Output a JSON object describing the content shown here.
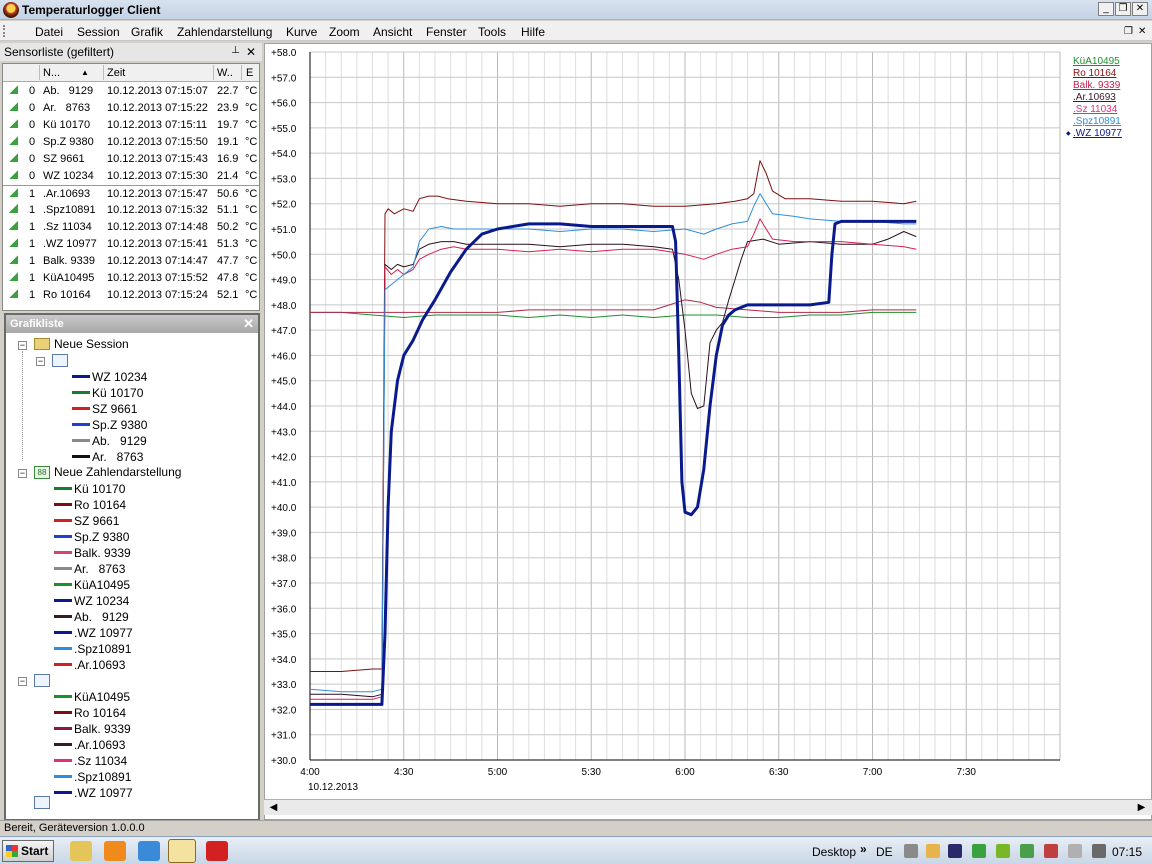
{
  "window": {
    "title": "Temperaturlogger Client",
    "min": "_",
    "max": "❐",
    "close": "✕"
  },
  "menu": [
    "Datei",
    "Session",
    "Grafik",
    "Zahlendarstellung",
    "Kurve",
    "Zoom",
    "Ansicht",
    "Fenster",
    "Tools",
    "Hilfe"
  ],
  "mdi": {
    "restore": "❐",
    "close": "✕"
  },
  "sensor_panel": {
    "title": "Sensorliste (gefiltert)",
    "pin": "⊥",
    "close": "✕",
    "columns": [
      "N...",
      "Zeit",
      "W..",
      "E"
    ],
    "rows": [
      [
        "0",
        "Ab.   9129",
        "10.12.2013 07:15:07",
        "22.7",
        "°C"
      ],
      [
        "0",
        "Ar.   8763",
        "10.12.2013 07:15:22",
        "23.9",
        "°C"
      ],
      [
        "0",
        "Kü 10170",
        "10.12.2013 07:15:11",
        "19.7",
        "°C"
      ],
      [
        "0",
        "Sp.Z 9380",
        "10.12.2013 07:15:50",
        "19.1",
        "°C"
      ],
      [
        "0",
        "SZ 9661",
        "10.12.2013 07:15:43",
        "16.9",
        "°C"
      ],
      [
        "0",
        "WZ 10234",
        "10.12.2013 07:15:30",
        "21.4",
        "°C"
      ],
      [
        "1",
        ".Ar.10693",
        "10.12.2013 07:15:47",
        "50.6",
        "°C"
      ],
      [
        "1",
        ".Spz10891",
        "10.12.2013 07:15:32",
        "51.1",
        "°C"
      ],
      [
        "1",
        ".Sz 11034",
        "10.12.2013 07:14:48",
        "50.2",
        "°C"
      ],
      [
        "1",
        ".WZ 10977",
        "10.12.2013 07:15:41",
        "51.3",
        "°C"
      ],
      [
        "1",
        "Balk. 9339",
        "10.12.2013 07:14:47",
        "47.7",
        "°C"
      ],
      [
        "1",
        "KüA10495",
        "10.12.2013 07:15:52",
        "47.8",
        "°C"
      ],
      [
        "1",
        "Ro 10164",
        "10.12.2013 07:15:24",
        "52.1",
        "°C"
      ]
    ]
  },
  "graf_panel": {
    "title": "Grafikliste",
    "close": "✕",
    "session": "Neue Session",
    "session_items": [
      {
        "name": "WZ 10234",
        "color": "#0a1a8c"
      },
      {
        "name": "Kü 10170",
        "color": "#1f7a2e"
      },
      {
        "name": "SZ 9661",
        "color": "#d42020"
      },
      {
        "name": "Sp.Z 9380",
        "color": "#1f3fd0"
      },
      {
        "name": "Ab.   9129",
        "color": "#8a8a8a"
      },
      {
        "name": "Ar.   8763",
        "color": "#111111"
      }
    ],
    "zahlen": "Neue Zahlendarstellung",
    "zahlen_items": [
      {
        "name": "Kü 10170",
        "color": "#1f7a2e"
      },
      {
        "name": "Ro 10164",
        "color": "#7a1010"
      },
      {
        "name": "SZ 9661",
        "color": "#d42020"
      },
      {
        "name": "Sp.Z 9380",
        "color": "#1f3fd0"
      },
      {
        "name": "Balk. 9339",
        "color": "#d6436b"
      },
      {
        "name": "Ar.   8763",
        "color": "#8a8a8a"
      },
      {
        "name": "KüA10495",
        "color": "#1f8f2e"
      },
      {
        "name": "WZ 10234",
        "color": "#0a1a8c"
      },
      {
        "name": "Ab.   9129",
        "color": "#3a1a1a"
      },
      {
        "name": ".WZ 10977",
        "color": "#0a1a8c"
      },
      {
        "name": ".Spz10891",
        "color": "#2f8fd8"
      },
      {
        "name": ".Ar.10693",
        "color": "#d42020"
      }
    ],
    "chart2_items": [
      {
        "name": "KüA10495",
        "color": "#1f8f2e"
      },
      {
        "name": "Ro 10164",
        "color": "#7a1010"
      },
      {
        "name": "Balk. 9339",
        "color": "#8a1a3a"
      },
      {
        "name": ".Ar.10693",
        "color": "#3a1a2a"
      },
      {
        "name": ".Sz 11034",
        "color": "#e0307a"
      },
      {
        "name": ".Spz10891",
        "color": "#2f8fd8"
      },
      {
        "name": ".WZ 10977",
        "color": "#0a1a8c"
      }
    ]
  },
  "status": "Bereit, Geräteversion 1.0.0.0",
  "legend": [
    {
      "name": "KüA10495",
      "color": "#1f8f2e"
    },
    {
      "name": "Ro 10164",
      "color": "#8a1010"
    },
    {
      "name": "Balk. 9339",
      "color": "#c0204a"
    },
    {
      "name": ".Ar.10693",
      "color": "#3a1a2a"
    },
    {
      "name": ".Sz 11034",
      "color": "#e0307a"
    },
    {
      "name": ".Spz10891",
      "color": "#2f8fd8"
    },
    {
      "name": ".WZ 10977",
      "color": "#0a1a8c"
    }
  ],
  "chart_data": {
    "type": "line",
    "xlabel": "",
    "ylabel": "",
    "date_label": "10.12.2013",
    "x_ticks": [
      "4:00",
      "4:30",
      "5:00",
      "5:30",
      "6:00",
      "6:30",
      "7:00",
      "7:30"
    ],
    "y_ticks": [
      "+30.0",
      "+31.0",
      "+32.0",
      "+33.0",
      "+34.0",
      "+35.0",
      "+36.0",
      "+37.0",
      "+38.0",
      "+39.0",
      "+40.0",
      "+41.0",
      "+42.0",
      "+43.0",
      "+44.0",
      "+45.0",
      "+46.0",
      "+47.0",
      "+48.0",
      "+49.0",
      "+50.0",
      "+51.0",
      "+52.0",
      "+53.0",
      "+54.0",
      "+55.0",
      "+56.0",
      "+57.0",
      "+58.0"
    ],
    "ylim": [
      30,
      58
    ],
    "grid": true,
    "legend_position": "top-right",
    "series": [
      {
        "name": "KüA10495",
        "color": "#1f8f2e",
        "width": 1,
        "points": [
          [
            0,
            47.7
          ],
          [
            10,
            47.7
          ],
          [
            20,
            47.6
          ],
          [
            30,
            47.5
          ],
          [
            40,
            47.6
          ],
          [
            50,
            47.6
          ],
          [
            60,
            47.6
          ],
          [
            70,
            47.5
          ],
          [
            80,
            47.6
          ],
          [
            90,
            47.5
          ],
          [
            100,
            47.6
          ],
          [
            110,
            47.5
          ],
          [
            120,
            47.6
          ],
          [
            130,
            47.6
          ],
          [
            140,
            47.5
          ],
          [
            150,
            47.5
          ],
          [
            160,
            47.6
          ],
          [
            170,
            47.6
          ],
          [
            180,
            47.7
          ],
          [
            190,
            47.7
          ],
          [
            194,
            47.7
          ]
        ]
      },
      {
        "name": "Ro 10164",
        "color": "#7a1010",
        "width": 1,
        "points": [
          [
            0,
            33.5
          ],
          [
            10,
            33.5
          ],
          [
            20,
            33.6
          ],
          [
            23,
            33.6
          ],
          [
            24,
            51.6
          ],
          [
            25,
            51.8
          ],
          [
            27,
            51.6
          ],
          [
            30,
            51.8
          ],
          [
            33,
            51.7
          ],
          [
            35,
            52.2
          ],
          [
            38,
            52.3
          ],
          [
            41,
            52.3
          ],
          [
            44,
            52.2
          ],
          [
            50,
            52.1
          ],
          [
            60,
            52.0
          ],
          [
            70,
            52.0
          ],
          [
            80,
            51.9
          ],
          [
            90,
            52.0
          ],
          [
            100,
            52.0
          ],
          [
            110,
            51.9
          ],
          [
            120,
            51.9
          ],
          [
            130,
            52.0
          ],
          [
            136,
            52.1
          ],
          [
            140,
            52.2
          ],
          [
            142,
            52.4
          ],
          [
            144,
            53.7
          ],
          [
            146,
            53.2
          ],
          [
            148,
            52.5
          ],
          [
            152,
            52.2
          ],
          [
            160,
            52.2
          ],
          [
            170,
            52.1
          ],
          [
            180,
            52.1
          ],
          [
            190,
            52.0
          ],
          [
            194,
            52.1
          ]
        ]
      },
      {
        "name": "Balk. 9339",
        "color": "#b0284a",
        "width": 1,
        "points": [
          [
            0,
            47.7
          ],
          [
            10,
            47.7
          ],
          [
            20,
            47.7
          ],
          [
            30,
            47.7
          ],
          [
            40,
            47.7
          ],
          [
            50,
            47.7
          ],
          [
            60,
            47.7
          ],
          [
            70,
            47.8
          ],
          [
            80,
            47.8
          ],
          [
            90,
            47.8
          ],
          [
            100,
            47.8
          ],
          [
            110,
            47.8
          ],
          [
            115,
            48.0
          ],
          [
            120,
            48.2
          ],
          [
            125,
            48.1
          ],
          [
            130,
            47.9
          ],
          [
            140,
            47.8
          ],
          [
            150,
            47.7
          ],
          [
            160,
            47.7
          ],
          [
            170,
            47.7
          ],
          [
            180,
            47.8
          ],
          [
            190,
            47.8
          ],
          [
            194,
            47.8
          ]
        ]
      },
      {
        "name": ".Ar.10693",
        "color": "#2a1020",
        "width": 1,
        "points": [
          [
            0,
            32.6
          ],
          [
            10,
            32.6
          ],
          [
            20,
            32.5
          ],
          [
            23,
            32.6
          ],
          [
            24,
            49.6
          ],
          [
            26,
            49.4
          ],
          [
            28,
            49.6
          ],
          [
            30,
            49.5
          ],
          [
            33,
            49.6
          ],
          [
            35,
            50.2
          ],
          [
            38,
            50.4
          ],
          [
            42,
            50.5
          ],
          [
            46,
            50.5
          ],
          [
            50,
            50.4
          ],
          [
            60,
            50.4
          ],
          [
            70,
            50.4
          ],
          [
            80,
            50.3
          ],
          [
            90,
            50.4
          ],
          [
            100,
            50.4
          ],
          [
            110,
            50.3
          ],
          [
            116,
            50.2
          ],
          [
            118,
            49.0
          ],
          [
            120,
            47.0
          ],
          [
            122,
            44.5
          ],
          [
            124,
            43.9
          ],
          [
            126,
            44.0
          ],
          [
            128,
            46.5
          ],
          [
            130,
            47.0
          ],
          [
            132,
            47.3
          ],
          [
            134,
            48.2
          ],
          [
            136,
            49.0
          ],
          [
            138,
            49.8
          ],
          [
            140,
            50.5
          ],
          [
            145,
            50.6
          ],
          [
            150,
            50.4
          ],
          [
            160,
            50.5
          ],
          [
            170,
            50.4
          ],
          [
            180,
            50.4
          ],
          [
            185,
            50.6
          ],
          [
            190,
            50.9
          ],
          [
            194,
            50.7
          ]
        ]
      },
      {
        "name": ".Sz 11034",
        "color": "#d42050",
        "width": 1,
        "points": [
          [
            0,
            32.4
          ],
          [
            10,
            32.4
          ],
          [
            20,
            32.4
          ],
          [
            23,
            32.5
          ],
          [
            24,
            49.5
          ],
          [
            26,
            49.2
          ],
          [
            28,
            49.4
          ],
          [
            30,
            49.2
          ],
          [
            33,
            49.4
          ],
          [
            35,
            49.8
          ],
          [
            38,
            50.0
          ],
          [
            42,
            50.2
          ],
          [
            46,
            50.3
          ],
          [
            50,
            50.2
          ],
          [
            60,
            50.2
          ],
          [
            70,
            50.1
          ],
          [
            80,
            50.2
          ],
          [
            90,
            50.1
          ],
          [
            100,
            50.2
          ],
          [
            110,
            50.2
          ],
          [
            120,
            50.0
          ],
          [
            126,
            49.8
          ],
          [
            130,
            50.0
          ],
          [
            135,
            50.2
          ],
          [
            140,
            50.3
          ],
          [
            142,
            50.8
          ],
          [
            144,
            51.4
          ],
          [
            146,
            51.0
          ],
          [
            148,
            50.6
          ],
          [
            155,
            50.5
          ],
          [
            160,
            50.5
          ],
          [
            170,
            50.5
          ],
          [
            180,
            50.4
          ],
          [
            190,
            50.3
          ],
          [
            194,
            50.2
          ]
        ]
      },
      {
        "name": ".Spz10891",
        "color": "#2f8fd8",
        "width": 1,
        "points": [
          [
            0,
            32.8
          ],
          [
            10,
            32.7
          ],
          [
            20,
            32.7
          ],
          [
            23,
            32.8
          ],
          [
            24,
            48.6
          ],
          [
            26,
            48.8
          ],
          [
            28,
            49.0
          ],
          [
            30,
            49.2
          ],
          [
            33,
            49.5
          ],
          [
            35,
            50.5
          ],
          [
            38,
            51.0
          ],
          [
            42,
            51.1
          ],
          [
            46,
            51.0
          ],
          [
            50,
            51.0
          ],
          [
            60,
            51.0
          ],
          [
            70,
            51.0
          ],
          [
            80,
            50.9
          ],
          [
            90,
            51.0
          ],
          [
            100,
            51.0
          ],
          [
            110,
            50.9
          ],
          [
            120,
            51.0
          ],
          [
            126,
            50.8
          ],
          [
            130,
            51.0
          ],
          [
            135,
            51.2
          ],
          [
            140,
            51.3
          ],
          [
            142,
            51.9
          ],
          [
            144,
            52.4
          ],
          [
            146,
            52.0
          ],
          [
            148,
            51.6
          ],
          [
            155,
            51.5
          ],
          [
            160,
            51.4
          ],
          [
            170,
            51.3
          ],
          [
            180,
            51.3
          ],
          [
            190,
            51.2
          ],
          [
            194,
            51.2
          ]
        ]
      },
      {
        "name": ".WZ 10977",
        "color": "#0a1a8c",
        "width": 3,
        "points": [
          [
            0,
            32.2
          ],
          [
            10,
            32.2
          ],
          [
            20,
            32.2
          ],
          [
            23,
            32.2
          ],
          [
            24,
            35.0
          ],
          [
            25,
            40.0
          ],
          [
            26,
            43.0
          ],
          [
            28,
            45.0
          ],
          [
            30,
            46.0
          ],
          [
            33,
            46.6
          ],
          [
            36,
            47.4
          ],
          [
            40,
            48.2
          ],
          [
            45,
            49.3
          ],
          [
            50,
            50.2
          ],
          [
            55,
            50.8
          ],
          [
            60,
            51.0
          ],
          [
            70,
            51.2
          ],
          [
            80,
            51.2
          ],
          [
            90,
            51.1
          ],
          [
            100,
            51.1
          ],
          [
            110,
            51.1
          ],
          [
            116,
            51.1
          ],
          [
            117,
            50.5
          ],
          [
            118,
            46.0
          ],
          [
            119,
            41.0
          ],
          [
            120,
            39.8
          ],
          [
            122,
            39.7
          ],
          [
            124,
            40.0
          ],
          [
            126,
            41.5
          ],
          [
            128,
            44.0
          ],
          [
            130,
            46.0
          ],
          [
            132,
            47.2
          ],
          [
            134,
            47.6
          ],
          [
            136,
            47.8
          ],
          [
            140,
            48.0
          ],
          [
            150,
            48.0
          ],
          [
            160,
            48.0
          ],
          [
            166,
            48.1
          ],
          [
            167,
            50.0
          ],
          [
            168,
            51.2
          ],
          [
            170,
            51.3
          ],
          [
            180,
            51.3
          ],
          [
            194,
            51.3
          ]
        ]
      }
    ]
  },
  "taskbar": {
    "start": "Start",
    "desktop": "Desktop",
    "chevrons": "»",
    "lang": "DE",
    "clock": "07:15"
  }
}
